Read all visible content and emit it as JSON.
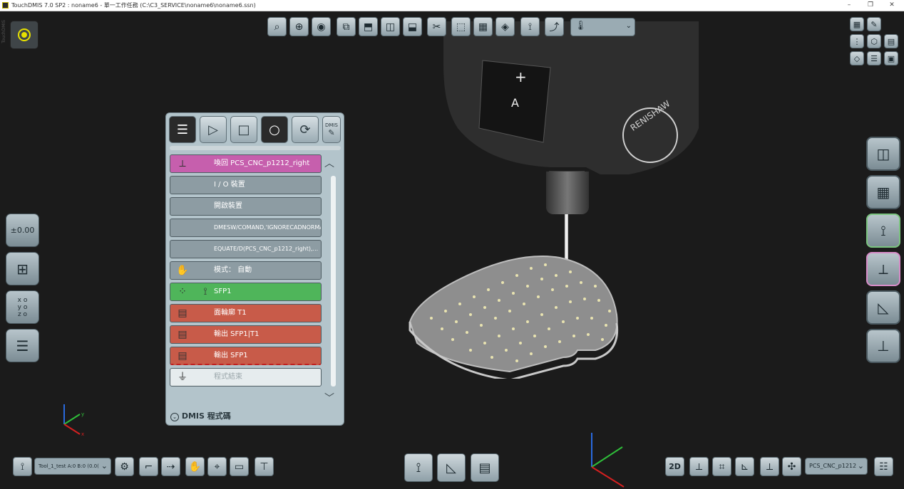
{
  "window": {
    "title": "TouchDMIS 7.0 SP2 :  noname6 - 單一工作任務   (C:\\C3_SERVICE\\noname6\\noname6.ssn)",
    "minimize": "–",
    "restore": "❐",
    "close": "✕"
  },
  "left_brand": "TouchDMIS",
  "top_toolbar": {
    "icons": [
      "zoom-fit-icon",
      "zoom-icon",
      "view-icon",
      "view-front-icon",
      "view-top-icon",
      "view-side-icon",
      "view-iso-icon",
      "clip-icon",
      "cube-icon",
      "cube-faces-icon",
      "layer-icon",
      "probe-point-icon",
      "axis-flip-icon"
    ],
    "thermometer_icon": "thermometer-icon"
  },
  "top_right_icons": [
    "grid-icon",
    "brush-icon",
    "joystick-icon",
    "cube-icon",
    "select-icon",
    "shapes-icon",
    "table-icon",
    "page-icon"
  ],
  "left_buttons": [
    {
      "name": "offset-button",
      "label": "±0.00"
    },
    {
      "name": "tree-button",
      "label": ""
    },
    {
      "name": "xyz-button",
      "label": "x o y o z o"
    },
    {
      "name": "list-button",
      "label": ""
    }
  ],
  "right_buttons": [
    "planes-icon",
    "table-icon",
    "probe-icon",
    "coordinate-icon",
    "measure-icon",
    "construct-icon"
  ],
  "program_panel": {
    "tools": [
      "menu-icon",
      "play-icon",
      "stop-icon",
      "record-icon",
      "refresh-icon",
      "dmis-edit-icon"
    ],
    "dmis_label": "DMIS",
    "rows": [
      {
        "style": "pink",
        "icon": "axis-icon",
        "text": "喚回 PCS_CNC_p1212_right"
      },
      {
        "style": "gray",
        "icon": "",
        "text": "I / O 裝置"
      },
      {
        "style": "gray",
        "icon": "",
        "text": "開啟裝置"
      },
      {
        "style": "gray",
        "icon": "",
        "text": "DMESW/COMAND,'IGNORECADNORMA..."
      },
      {
        "style": "gray",
        "icon": "",
        "text": "EQUATE/D(PCS_CNC_p1212_right),..."
      },
      {
        "style": "gray",
        "icon": "hand-icon",
        "text": "模式： 自動"
      },
      {
        "style": "green",
        "icon": "probe-icon",
        "text": "SFP1"
      },
      {
        "style": "red",
        "icon": "doc-icon",
        "text": "面輪廓 T1"
      },
      {
        "style": "red",
        "icon": "doc-icon",
        "text": "輸出 SFP1|T1"
      },
      {
        "style": "red",
        "icon": "doc-icon",
        "text": "輸出 SFP1"
      },
      {
        "style": "white",
        "icon": "end-icon",
        "text": "程式結束"
      }
    ],
    "footer": "DMIS 程式碼",
    "scroll_up": "︿",
    "scroll_down": "﹀"
  },
  "bottom_toolbar": {
    "probe_select": "Tool_1_test A:0 B:0 (0.0(",
    "icons": [
      "probe-icon",
      "probe-change-icon",
      "step-icon",
      "path-icon",
      "hand-icon",
      "joystick-icon",
      "screen-icon",
      "tip-icon"
    ],
    "center_icons": [
      "probe-icon",
      "measure-icon",
      "report-icon"
    ],
    "right_label_2d": "2D",
    "right_icons": [
      "align-icon",
      "crop-icon",
      "axis-icon",
      "axis2-icon",
      "fan-icon"
    ],
    "csys_select": "PCS_CNC_p1212",
    "settings_icon": "settings-icon"
  },
  "axes": {
    "x": "x",
    "y": "y"
  }
}
